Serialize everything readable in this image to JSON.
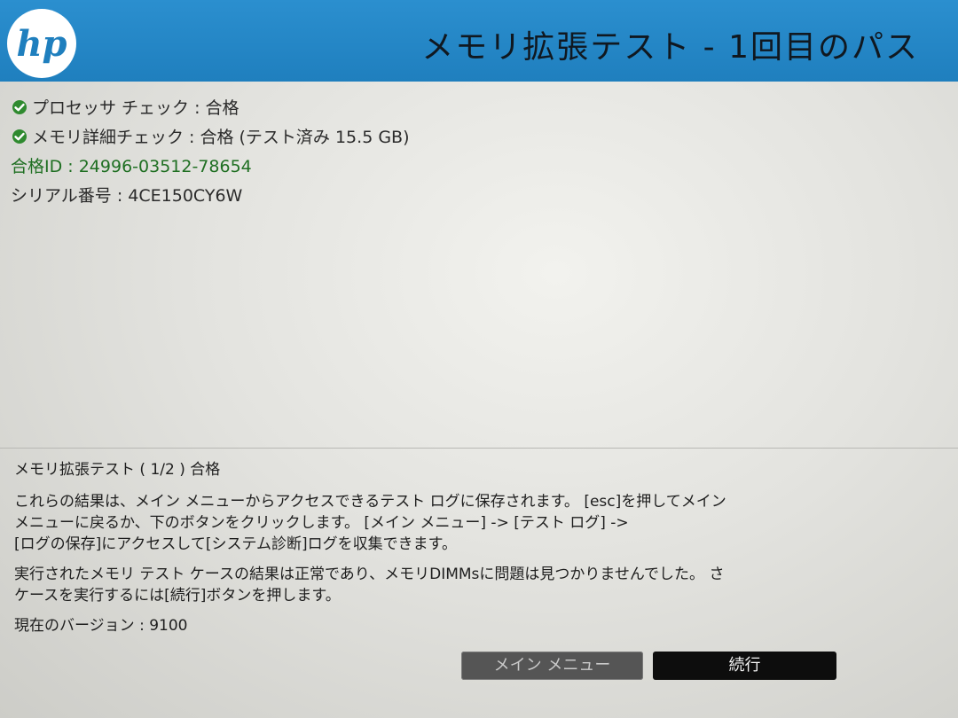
{
  "header": {
    "logo_text": "hp",
    "title": "メモリ拡張テスト - 1回目のパス",
    "accent_color": "#1f7fbe"
  },
  "status": {
    "processor_check": "プロセッサ チェック : 合格",
    "memory_check": "メモリ詳細チェック : 合格 (テスト済み 15.5 GB)",
    "pass_id": "合格ID : 24996-03512-78654",
    "serial": "シリアル番号 : 4CE150CY6W",
    "check_icon": "check-circle-icon",
    "pass_color": "#1f6f22"
  },
  "result": {
    "title": "メモリ拡張テスト ( 1/2 )  合格",
    "paragraph1": [
      "これらの結果は、メイン メニューからアクセスできるテスト ログに保存されます。 [esc]を押してメイン",
      "メニューに戻るか、下のボタンをクリックします。 [メイン メニュー] -> [テスト ログ] ->",
      "[ログの保存]にアクセスして[システム診断]ログを収集できます。"
    ],
    "paragraph2": [
      "実行されたメモリ テスト ケースの結果は正常であり、メモリDIMMsに問題は見つかりませんでした。 さ",
      "ケースを実行するには[続行]ボタンを押します。"
    ],
    "version": "現在のバージョン : 9100"
  },
  "buttons": {
    "main_menu": "メイン メニュー",
    "continue": "続行"
  }
}
